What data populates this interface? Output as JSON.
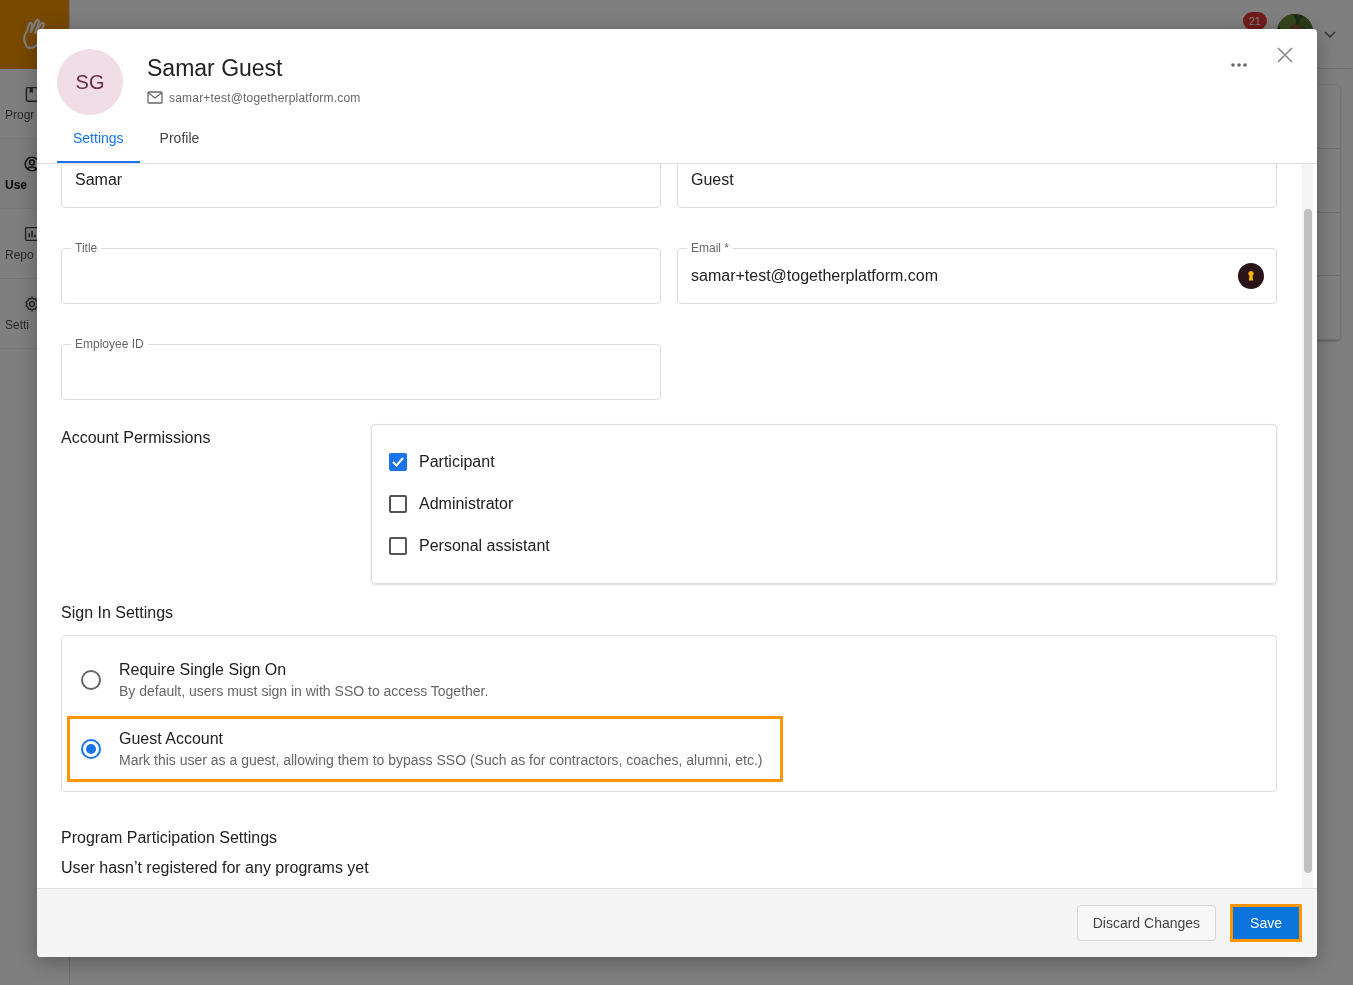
{
  "background": {
    "sidebar": [
      {
        "label": "Progr",
        "kind": "book",
        "selected": false
      },
      {
        "label": "Use",
        "kind": "user",
        "selected": true
      },
      {
        "label": "Repo",
        "kind": "chart",
        "selected": false
      },
      {
        "label": "Setti",
        "kind": "gear",
        "selected": false
      }
    ],
    "notification_count": "21"
  },
  "dialog": {
    "initials": "SG",
    "name": "Samar Guest",
    "email": "samar+test@togetherplatform.com",
    "tabs": [
      {
        "label": "Settings",
        "selected": true
      },
      {
        "label": "Profile",
        "selected": false
      }
    ]
  },
  "fields": [
    {
      "value": "Samar",
      "password_manager": false
    },
    {
      "value": "Guest",
      "password_manager": false
    },
    {
      "label": "Title",
      "password_manager": false
    },
    {
      "label": "Email *",
      "value": "samar+test@togetherplatform.com",
      "password_manager": true
    },
    {
      "label": "Employee ID",
      "password_manager": false
    }
  ],
  "account_permissions": {
    "heading": "Account Permissions",
    "options": [
      {
        "label": "Participant",
        "checked": true
      },
      {
        "label": "Administrator",
        "checked": false
      },
      {
        "label": "Personal assistant",
        "checked": false
      }
    ]
  },
  "sign_in": {
    "heading": "Sign In Settings",
    "options": [
      {
        "title": "Require Single Sign On",
        "description": "By default, users must sign in with SSO to access Together.",
        "selected": false,
        "highlighted": false
      },
      {
        "title": "Guest Account",
        "description": "Mark this user as a guest, allowing them to bypass SSO (Such as for contractors, coaches, alumni, etc.)",
        "selected": true,
        "highlighted": true
      }
    ]
  },
  "program_participation": {
    "heading": "Program Participation Settings",
    "text": "User hasn’t registered for any programs yet"
  },
  "footer": {
    "buttons": [
      {
        "label": "Discard Changes",
        "kind": "secondary",
        "highlighted": false
      },
      {
        "label": "Save",
        "kind": "primary",
        "highlighted": true
      }
    ]
  }
}
